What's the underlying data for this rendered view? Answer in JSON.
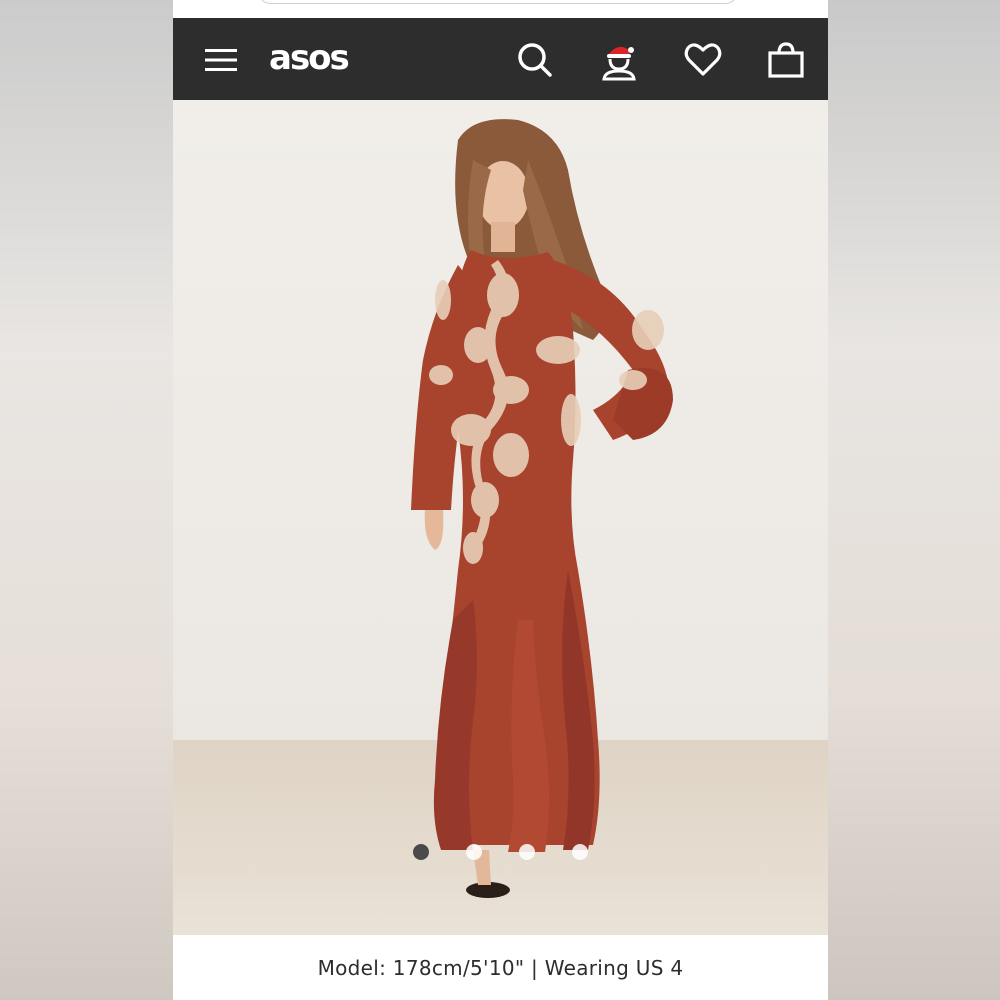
{
  "header": {
    "logo_text": "asos",
    "background_color": "#2d2d2d",
    "icons": [
      "menu-icon",
      "search-icon",
      "account-santa-icon",
      "heart-icon",
      "bag-icon"
    ]
  },
  "gallery": {
    "image_alt": "Model wearing a rust red long-sleeve maxi dress with floral embroidery and ruffle hem",
    "dress_color": "#a8432e",
    "embroidery_color": "#e8cfb8",
    "dots": {
      "count": 4,
      "active_index": 0
    }
  },
  "caption": {
    "text": "Model: 178cm/5'10\" | Wearing US 4"
  }
}
